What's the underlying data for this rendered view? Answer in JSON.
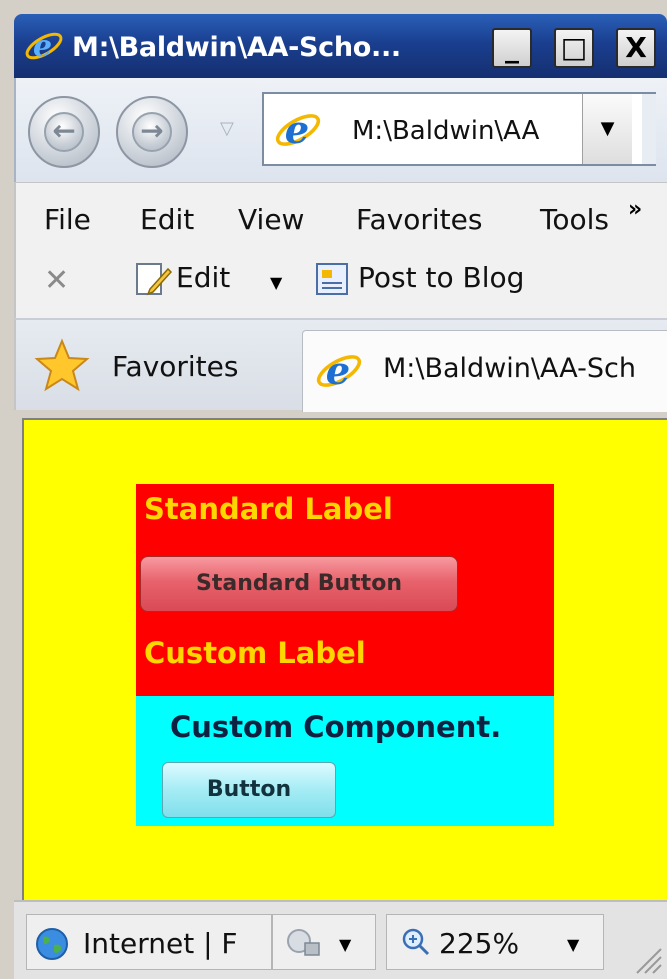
{
  "window": {
    "title": "M:\\Baldwin\\AA-Scho...",
    "minimize": "_",
    "maximize": "□",
    "close": "X"
  },
  "address_bar": {
    "url": "M:\\Baldwin\\AA"
  },
  "menu": {
    "items": [
      "File",
      "Edit",
      "View",
      "Favorites",
      "Tools"
    ],
    "overflow": "»"
  },
  "command_bar": {
    "edit_label": "Edit",
    "post_label": "Post to Blog"
  },
  "favorites_bar": {
    "label": "Favorites"
  },
  "tab": {
    "title": "M:\\Baldwin\\AA-Sch"
  },
  "content": {
    "standard_label": "Standard Label",
    "standard_button": "Standard Button",
    "custom_label": "Custom Label",
    "custom_component": "Custom Component.",
    "custom_button": "Button",
    "background_color": "#ffff00",
    "red_panel_color": "#ff0000",
    "cyan_panel_color": "#00ffff",
    "label_color": "#ffd700"
  },
  "status_bar": {
    "zone": "Internet | F",
    "zoom": "225%"
  },
  "icons": {
    "ie": "ie-logo-icon",
    "back": "back-icon",
    "forward": "forward-icon",
    "stop": "stop-icon",
    "edit": "edit-page-icon",
    "blog": "post-to-blog-icon",
    "star": "favorites-star-icon",
    "globe": "internet-zone-icon",
    "lock": "protected-mode-icon",
    "zoom": "zoom-icon"
  }
}
